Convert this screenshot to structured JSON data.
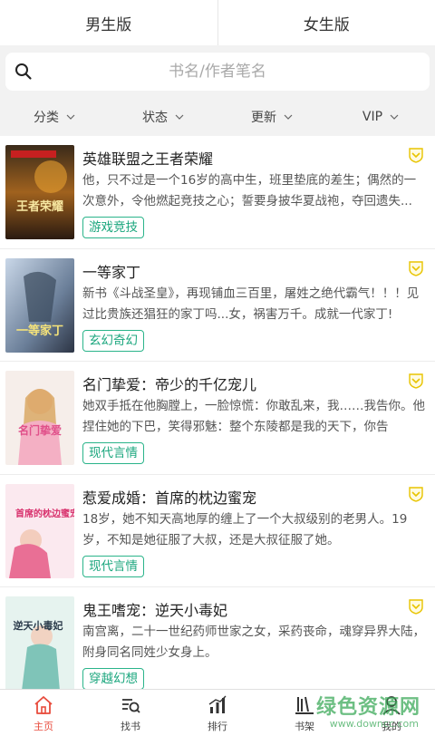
{
  "gender_tabs": [
    {
      "label": "男生版"
    },
    {
      "label": "女生版"
    }
  ],
  "search": {
    "placeholder": "书名/作者笔名"
  },
  "filters": [
    {
      "label": "分类"
    },
    {
      "label": "状态"
    },
    {
      "label": "更新"
    },
    {
      "label": "VIP"
    }
  ],
  "books": [
    {
      "title": "英雄联盟之王者荣耀",
      "desc": "他，只不过是一个16岁的高中生，班里垫底的差生；偶然的一次意外，令他燃起竞技之心；誓要身披华夏战袍，夺回遗失...",
      "tag": "游戏竞技",
      "cover_text": "王者荣耀"
    },
    {
      "title": "一等家丁",
      "desc": "新书《斗战圣皇》，再现铺血三百里，屠姓之绝代霸气！！！见过比贵族还猖狂的家丁吗...女，祸害万千。成就一代家丁!",
      "tag": "玄幻奇幻",
      "cover_text": "一等家丁"
    },
    {
      "title": "名门挚爱：帝少的千亿宠儿",
      "desc": "她双手抵在他胸膛上，一脸惊慌：你敢乱来，我……我告你。他捏住她的下巴，笑得邪魅：整个东陵都是我的天下，你告",
      "tag": "现代言情",
      "cover_text": "名门挚爱"
    },
    {
      "title": "惹爱成婚：首席的枕边蜜宠",
      "desc": "18岁，她不知天高地厚的缠上了一个大叔级别的老男人。19岁，不知是她征服了大叔，还是大叔征服了她。",
      "tag": "现代言情",
      "cover_text": "首席的枕边蜜宠"
    },
    {
      "title": "鬼王嗜宠：逆天小毒妃",
      "desc": "南宫离，二十一世纪药师世家之女，采药丧命，魂穿异界大陆，附身同名同姓少女身上。",
      "tag": "穿越幻想",
      "cover_text": "逆天小毒妃"
    }
  ],
  "tabbar": [
    {
      "label": "主页",
      "icon": "home-icon"
    },
    {
      "label": "找书",
      "icon": "book-search-icon"
    },
    {
      "label": "排行",
      "icon": "ranking-icon"
    },
    {
      "label": "书架",
      "icon": "bookshelf-icon"
    },
    {
      "label": "我的",
      "icon": "user-icon"
    }
  ],
  "watermark": {
    "main": "绿色资源网",
    "sub": "www.downcc.com"
  },
  "colors": {
    "accent_green": "#1aa67d",
    "active_tab": "#e84c3d",
    "vip_yellow": "#e8c400"
  }
}
